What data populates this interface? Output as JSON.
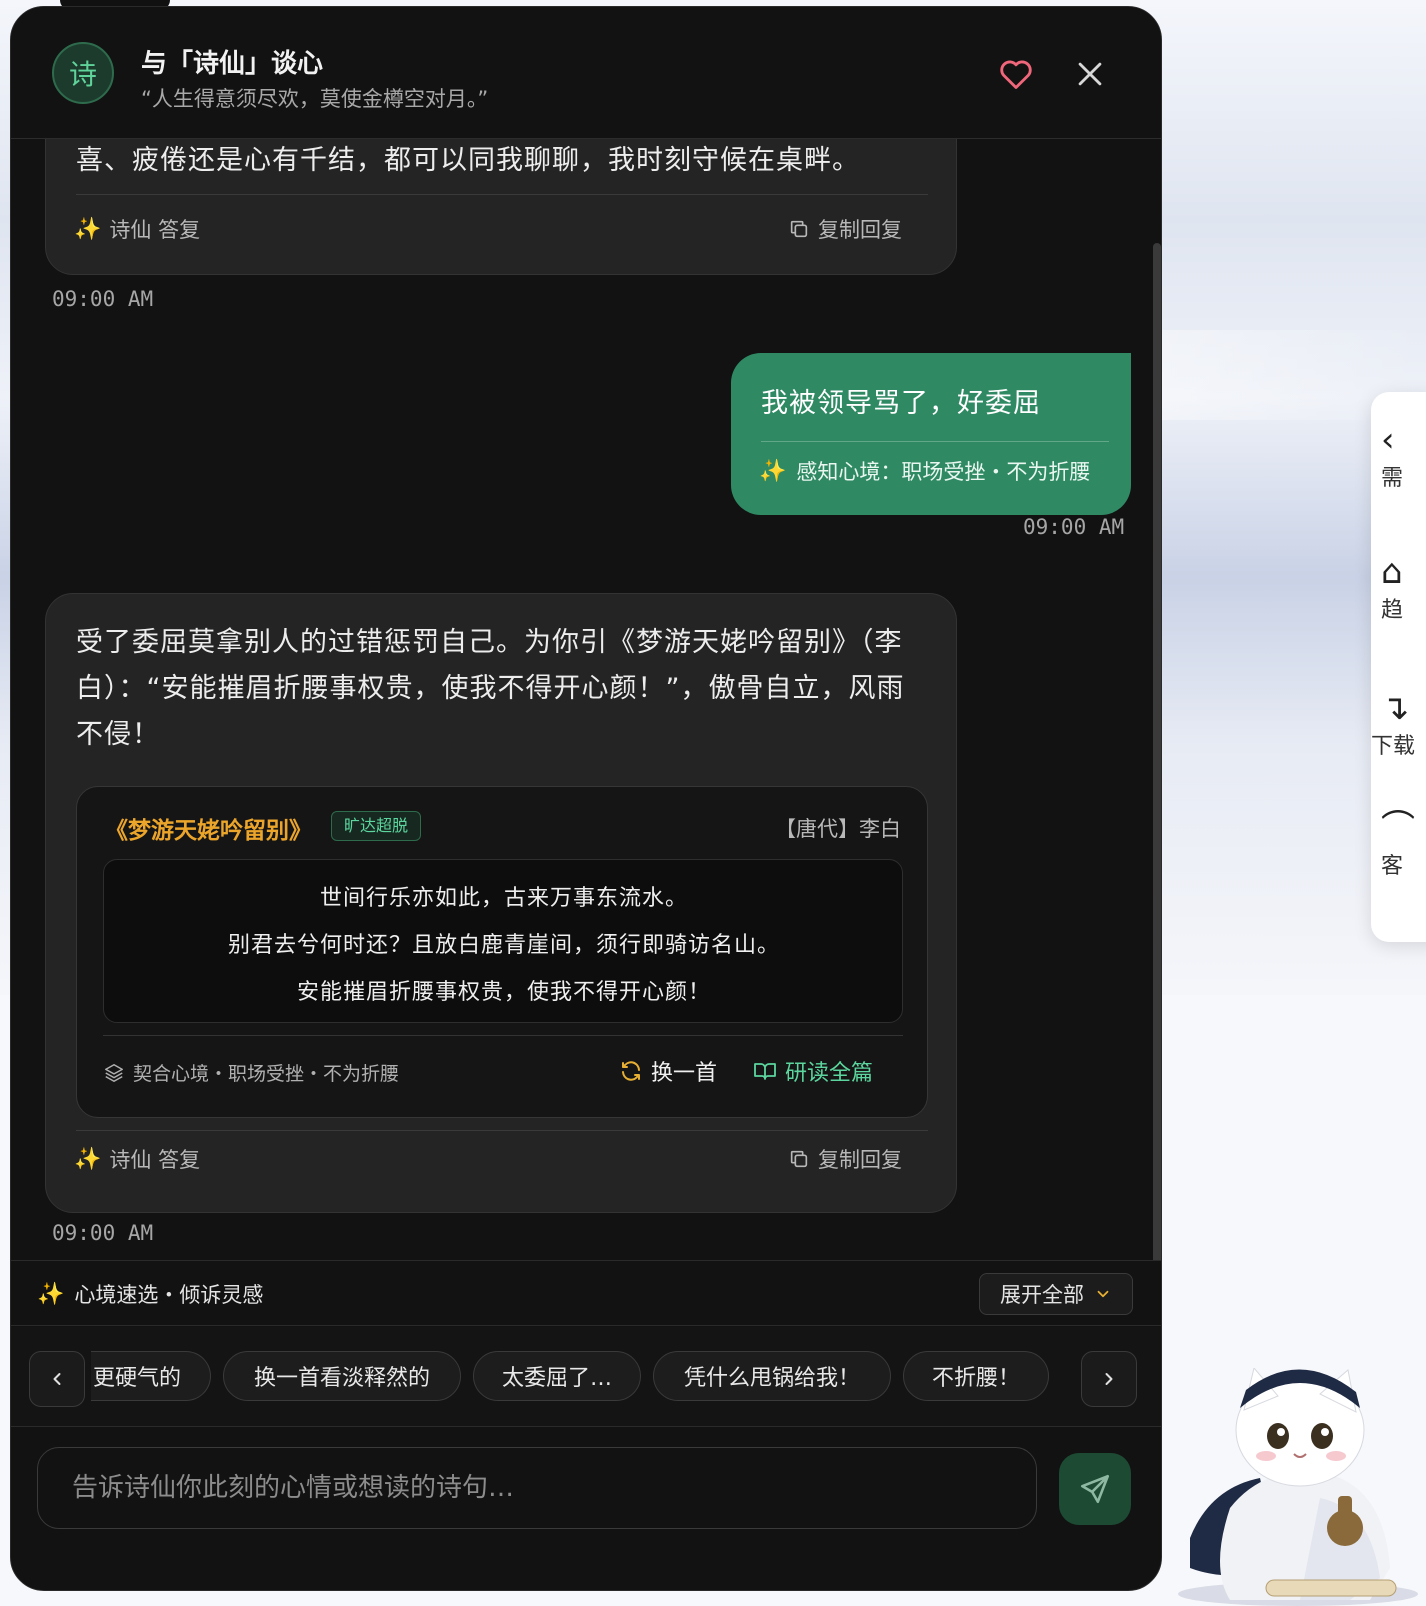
{
  "header": {
    "avatar_char": "诗",
    "title": "与「诗仙」谈心",
    "subtitle": "“人生得意须尽欢，莫使金樽空对月。”"
  },
  "messages": {
    "ai1": {
      "text": "喜、疲倦还是心有千结，都可以同我聊聊，我时刻守候在桌畔。",
      "by": "诗仙 答复",
      "copy": "复制回复",
      "time": "09:00 AM"
    },
    "user1": {
      "text": "我被领导骂了，好委屈",
      "tag": "感知心境：职场受挫・不为折腰",
      "time": "09:00 AM"
    },
    "ai2": {
      "line1": "受了委屈莫拿别人的过错惩罚自己。为你引《梦游天姥吟留别》（李",
      "line2": "白）：“安能摧眉折腰事权贵，使我不得开心颜！”，傲骨自立，风雨",
      "line3": "不侵！",
      "poem": {
        "title": "《梦游天姥吟留别》",
        "badge": "旷达超脱",
        "author": "【唐代】李白",
        "lines": [
          "世间行乐亦如此，古来万事东流水。",
          "别君去兮何时还？且放白鹿青崖间，须行即骑访名山。",
          "安能摧眉折腰事权贵，使我不得开心颜！"
        ],
        "mood": "契合心境・职场受挫・不为折腰",
        "swap": "换一首",
        "read": "研读全篇"
      },
      "by": "诗仙 答复",
      "copy": "复制回复",
      "time": "09:00 AM"
    }
  },
  "quick": {
    "label": "心境速选・倾诉灵感",
    "expand": "展开全部",
    "chips": [
      "更硬气的",
      "换一首看淡释然的",
      "太委屈了…",
      "凭什么甩锅给我！",
      "不折腰！"
    ]
  },
  "input": {
    "placeholder": "告诉诗仙你此刻的心情或想读的诗句…"
  },
  "side_menu": {
    "items": [
      "需",
      "趋",
      "下载",
      "客"
    ]
  },
  "colors": {
    "accent_green": "#2f8a64",
    "gold": "#eba52a",
    "panel_bg": "#121212"
  }
}
